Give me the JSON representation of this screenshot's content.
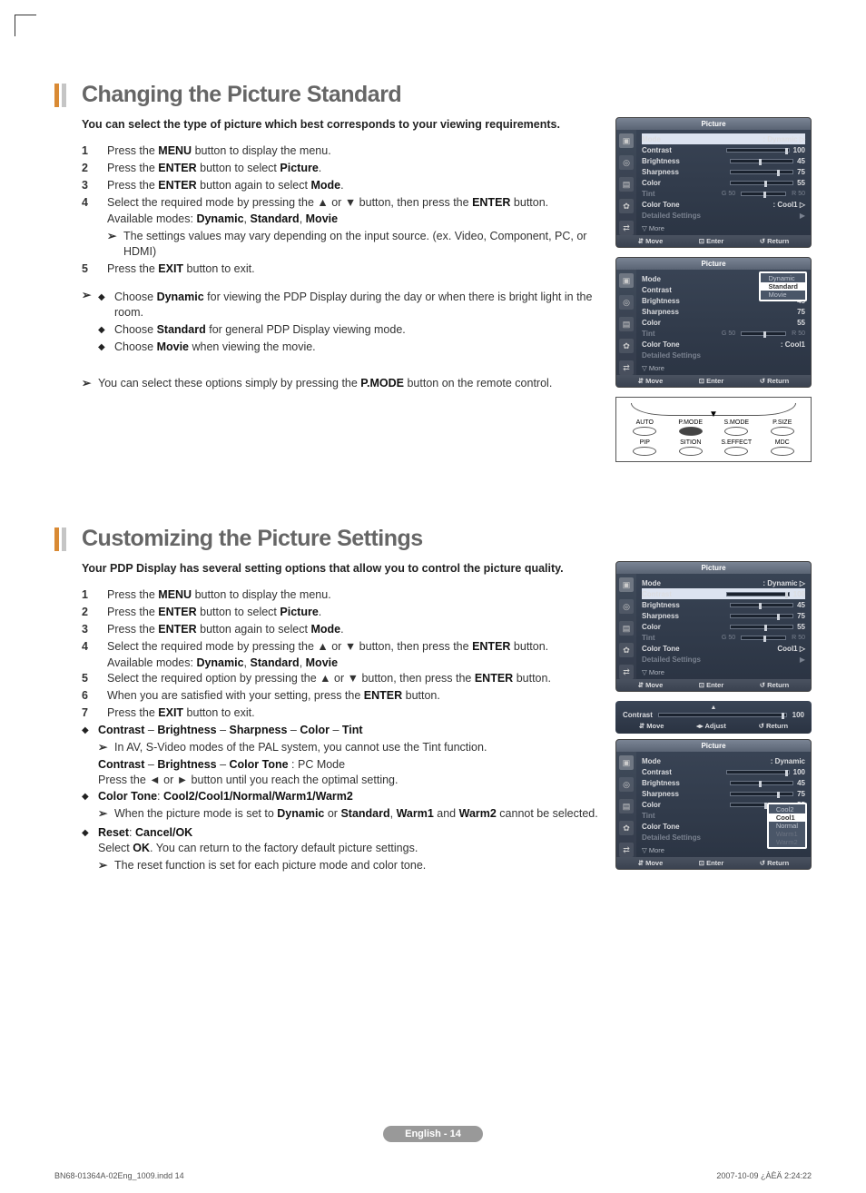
{
  "section1": {
    "title": "Changing the Picture Standard",
    "intro": "You can select the type of picture which best corresponds to your viewing requirements.",
    "steps": [
      "Press the <b>MENU</b> button to display the menu.",
      "Press the <b>ENTER</b> button to select <b>Picture</b>.",
      "Press the <b>ENTER</b> button again to select <b>Mode</b>.",
      "Select the required mode by pressing the ▲ or ▼ button, then press the <b>ENTER</b> button.",
      "Press the <b>EXIT</b> button to exit."
    ],
    "available_modes": "Available modes: <b>Dynamic</b>, <b>Standard</b>, <b>Movie</b>",
    "mode_note": "The settings values may vary depending on the input source. (ex. Video, Component, PC, or HDMI)",
    "bullets": [
      "Choose <b>Dynamic</b> for viewing the PDP Display during the day or when there is bright light in the room.",
      "Choose <b>Standard</b> for general PDP Display viewing mode.",
      "Choose <b>Movie</b> when viewing the movie."
    ],
    "pmode_note": "You can select these options simply by pressing the <b>P.MODE</b> button on the remote control."
  },
  "section2": {
    "title": "Customizing the Picture Settings",
    "intro": "Your PDP Display has several setting options that allow you to control the picture quality.",
    "steps": [
      "Press the <b>MENU</b> button to display the menu.",
      "Press the <b>ENTER</b> button to select <b>Picture</b>.",
      "Press the <b>ENTER</b> button again to select <b>Mode</b>.",
      "Select the required mode by pressing the ▲ or ▼ button, then press the <b>ENTER</b> button.",
      "Select the required option by pressing the ▲ or ▼ button, then press the <b>ENTER</b> button.",
      "When you are satisfied with your setting, press the <b>ENTER</b> button.",
      "Press the <b>EXIT</b> button to exit."
    ],
    "available_modes": "Available modes: <b>Dynamic</b>, <b>Standard</b>, <b>Movie</b>",
    "bullet1_title": "<b>Contrast</b> – <b>Brightness</b> – <b>Sharpness</b> – <b>Color</b> – <b>Tint</b>",
    "bullet1_note": "In AV, S-Video modes of the PAL system, you cannot use the Tint function.",
    "bullet1_pc": "<b>Contrast</b> – <b>Brightness</b> – <b>Color Tone</b> : PC Mode",
    "bullet1_press": "Press the ◄ or ► button until you reach the optimal setting.",
    "bullet2_title": "<b>Color Tone</b>: <b>Cool2/Cool1/Normal/Warm1/Warm2</b>",
    "bullet2_note": "When the picture mode is set to <b>Dynamic</b> or <b>Standard</b>, <b>Warm1</b> and <b>Warm2</b> cannot be selected.",
    "bullet3_title": "<b>Reset</b>: <b>Cancel/OK</b>",
    "bullet3_txt": "Select <b>OK</b>. You can return to the factory default picture settings.",
    "bullet3_note": "The reset function is set for each picture mode and color tone."
  },
  "osd": {
    "title": "Picture",
    "mode_label": "Mode",
    "mode_val": ": Dynamic",
    "contrast_label": "Contrast",
    "contrast_val": "100",
    "brightness_label": "Brightness",
    "brightness_val": "45",
    "sharpness_label": "Sharpness",
    "sharpness_val": "75",
    "color_label": "Color",
    "color_val": "55",
    "tint_label": "Tint",
    "tint_g": "G",
    "tint_gv": "50",
    "tint_r": "R",
    "tint_rv": "50",
    "colortone_label": "Color Tone",
    "colortone_val": ": Cool1",
    "colortone_val2": "Cool1",
    "detailed_label": "Detailed Settings",
    "more": "▽ More",
    "foot_move": "Move",
    "foot_enter": "Enter",
    "foot_return": "Return",
    "foot_adjust": "Adjust",
    "popup_modes": [
      "Dynamic",
      "Standard",
      "Movie"
    ],
    "popup_tones": [
      "Cool2",
      "Cool1",
      "Normal",
      "Warm1",
      "Warm2"
    ]
  },
  "contrast_only": {
    "label": "Contrast",
    "val": "100"
  },
  "remote": {
    "row1": [
      "AUTO",
      "P.MODE",
      "S.MODE",
      "P.SIZE"
    ],
    "row2": [
      "PIP",
      "SITION",
      "S.EFFECT",
      "MDC"
    ]
  },
  "footer": "English - 14",
  "imprint_left": "BN68-01364A-02Eng_1009.indd   14",
  "imprint_right": "2007-10-09   ¿ÀÈÄ 2:24:22"
}
